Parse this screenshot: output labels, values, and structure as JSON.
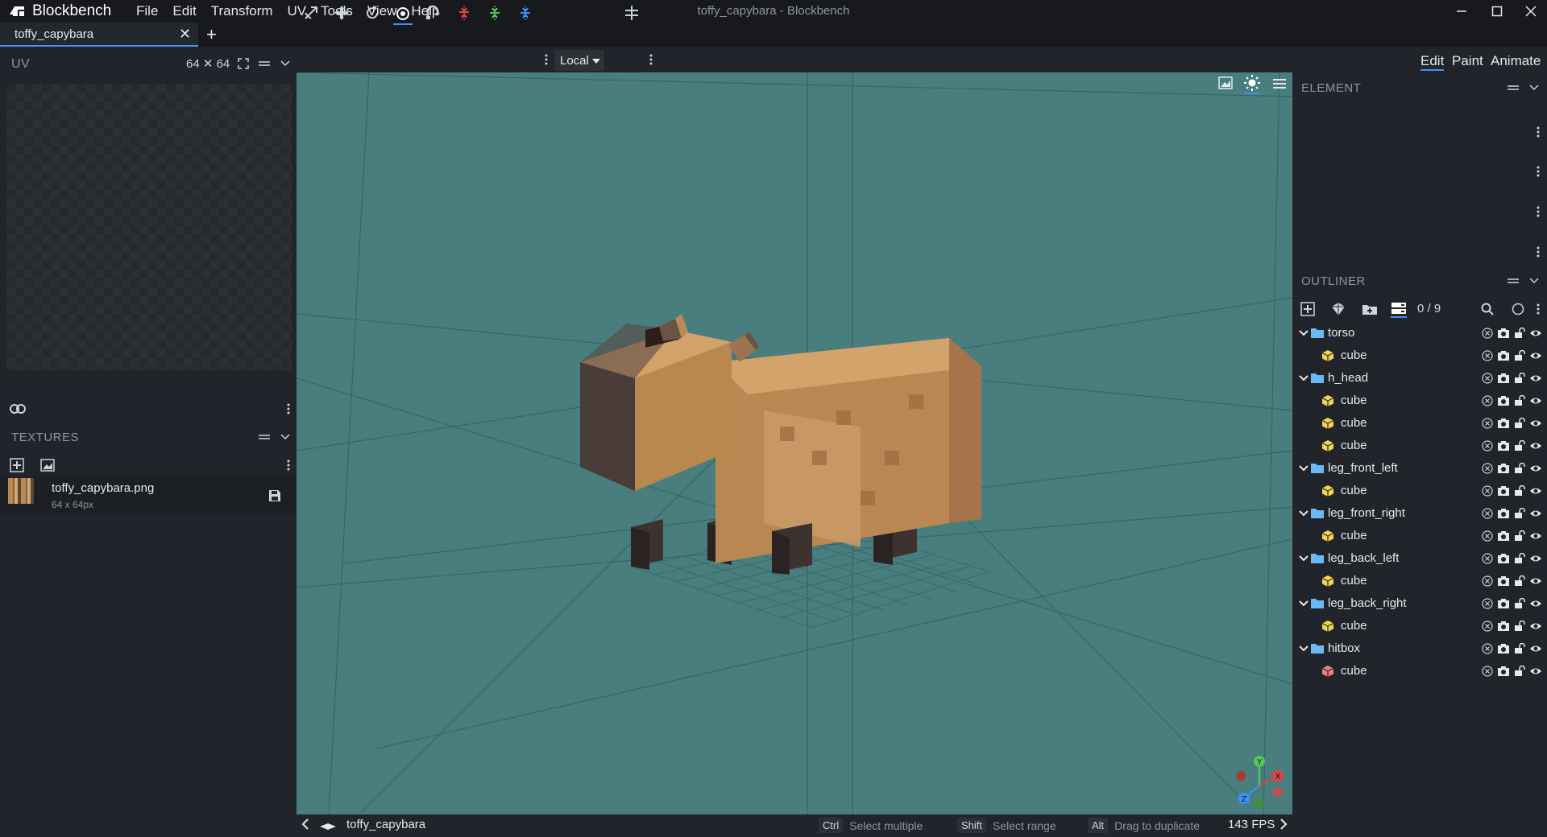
{
  "app": {
    "name": "Blockbench",
    "window_title": "toffy_capybara - Blockbench",
    "menu": [
      "File",
      "Edit",
      "Transform",
      "UV",
      "Tools",
      "View",
      "Help"
    ]
  },
  "tabs": {
    "file_tab": "toffy_capybara",
    "close_glyph": "✕",
    "new_tab_glyph": "+"
  },
  "uv_panel": {
    "title": "UV",
    "size_label": "64 ✕ 64"
  },
  "textures_panel": {
    "title": "TEXTURES",
    "items": [
      {
        "name": "toffy_capybara.png",
        "size": "64 x 64px"
      }
    ]
  },
  "toolbar": {
    "space_mode": "Local",
    "tools": [
      "move-icon",
      "drag-icon",
      "rotate-icon",
      "pivot-icon",
      "vertex-snap-icon",
      "mirror-x-icon",
      "mirror-y-icon",
      "mirror-z-icon"
    ]
  },
  "modes": {
    "items": [
      "Edit",
      "Paint",
      "Animate"
    ],
    "active": "Edit",
    "accent": "#3e90ff"
  },
  "element_panel": {
    "title": "ELEMENT"
  },
  "outliner": {
    "title": "OUTLINER",
    "count": "0 / 9",
    "rows": [
      {
        "type": "group",
        "label": "torso"
      },
      {
        "type": "cube",
        "label": "cube"
      },
      {
        "type": "group",
        "label": "h_head"
      },
      {
        "type": "cube",
        "label": "cube"
      },
      {
        "type": "cube",
        "label": "cube"
      },
      {
        "type": "cube",
        "label": "cube"
      },
      {
        "type": "group",
        "label": "leg_front_left"
      },
      {
        "type": "cube",
        "label": "cube"
      },
      {
        "type": "group",
        "label": "leg_front_right"
      },
      {
        "type": "cube",
        "label": "cube"
      },
      {
        "type": "group",
        "label": "leg_back_left"
      },
      {
        "type": "cube",
        "label": "cube"
      },
      {
        "type": "group",
        "label": "leg_back_right"
      },
      {
        "type": "cube",
        "label": "cube"
      },
      {
        "type": "group",
        "label": "hitbox"
      },
      {
        "type": "cube-hitbox",
        "label": "cube"
      }
    ],
    "folder_color": "#6bb8f5",
    "cube_color": "#f1d64f",
    "hitbox_cube_color": "#f08080"
  },
  "viewport": {
    "background": "#497e7e",
    "gizmo_labels": {
      "y": "Y",
      "x": "X",
      "z": "Z"
    }
  },
  "statusbar": {
    "model_name": "toffy_capybara",
    "hints": [
      {
        "key": "Ctrl",
        "text": "Select multiple"
      },
      {
        "key": "Shift",
        "text": "Select range"
      },
      {
        "key": "Alt",
        "text": "Drag to duplicate"
      }
    ],
    "fps": "143 FPS"
  }
}
